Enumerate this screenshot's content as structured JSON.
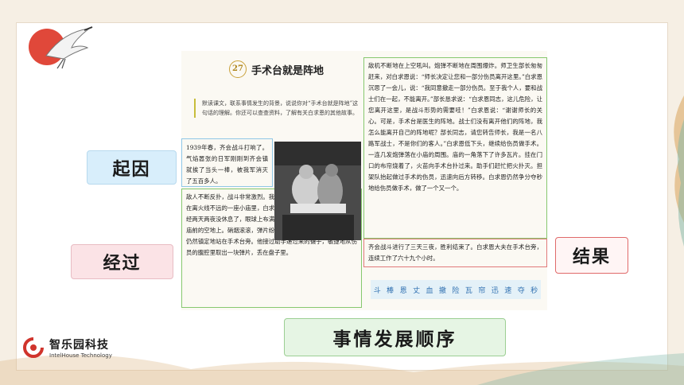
{
  "lesson": {
    "number": "27",
    "title": "手术台就是阵地",
    "intro": "默读课文，联系事情发生的背景，说说你对“手术台就是阵地”这句话的理解。你还可以查查资料，了解有关白求恩的其他故事。"
  },
  "text_blocks": {
    "cause": "1939年春，齐会战斗打响了。气焰嚣张的日军刚刚到齐会镇就挨了当头一棒，被我军消灭了五百多人。",
    "process_left": "敌人不断反扑，战斗非常激烈。我军的伤员陆续从火线上抬下来。在离火线不远的一座小庙里，白求恩大夫正在给伤员做手术。他已经两天两夜没休息了，眼球上布满了血丝。突然，几发炮弹落在小庙前的空地上。硝烟滚滚，弹片纷飞，小庙被烟雾淹没了。白求恩仍然镇定地站在手术台旁。他接过助手递过来的镊子，敏捷地从伤员的腹腔里取出一块弹片，丢在盘子里。",
    "process_right": "敌机不断地在上空吼叫。炮弹不断地在周围爆炸。师卫生部长匆匆赶来，对白求恩说：“师长决定让您和一部分伤员离开这里。”白求恩沉思了一会儿，说：“我同意撤走一部分伤员。至于我个人，要和战士们在一起，不能离开。”部长恳求说：“白求恩同志，这儿危险，让您离开这里，是战斗形势的需要哇！”白求恩说：“谢谢师长的关心。可是，手术台是医生的阵地。战士们没有离开他们的阵地，我怎么能离开自己的阵地呢？部长同志，请您转告师长，我是一名八路军战士，不是你们的客人。”白求恩低下头，继续给伤员做手术。一连几发炮弹落在小庙的周围。庙的一角落下了许多瓦片。挂在门口的布帘烧着了，火苗向手术台扑过来。助手们赶忙把火扑灭。担架队抬起做过手术的伤员，迅速向后方转移。白求恩仍然争分夺秒地给伤员做手术，做了一个又一个。",
    "result": "齐会战斗进行了三天三夜，胜利结束了。白求恩大夫在手术台旁，连续工作了六十九个小时。"
  },
  "char_strip": [
    "斗",
    "棒",
    "恩",
    "丈",
    "血",
    "撤",
    "险",
    "瓦",
    "帘",
    "迅",
    "速",
    "夺",
    "秒"
  ],
  "labels": {
    "cause": "起因",
    "process": "经过",
    "result": "结果",
    "order": "事情发展顺序"
  },
  "brand": {
    "name": "智乐园科技",
    "english": "IntelHouse Technology"
  },
  "colors": {
    "accent_red": "#e0483a",
    "cause_blue": "#8fc7e6",
    "process_green": "#86c86e",
    "result_red": "#e07a7a"
  }
}
